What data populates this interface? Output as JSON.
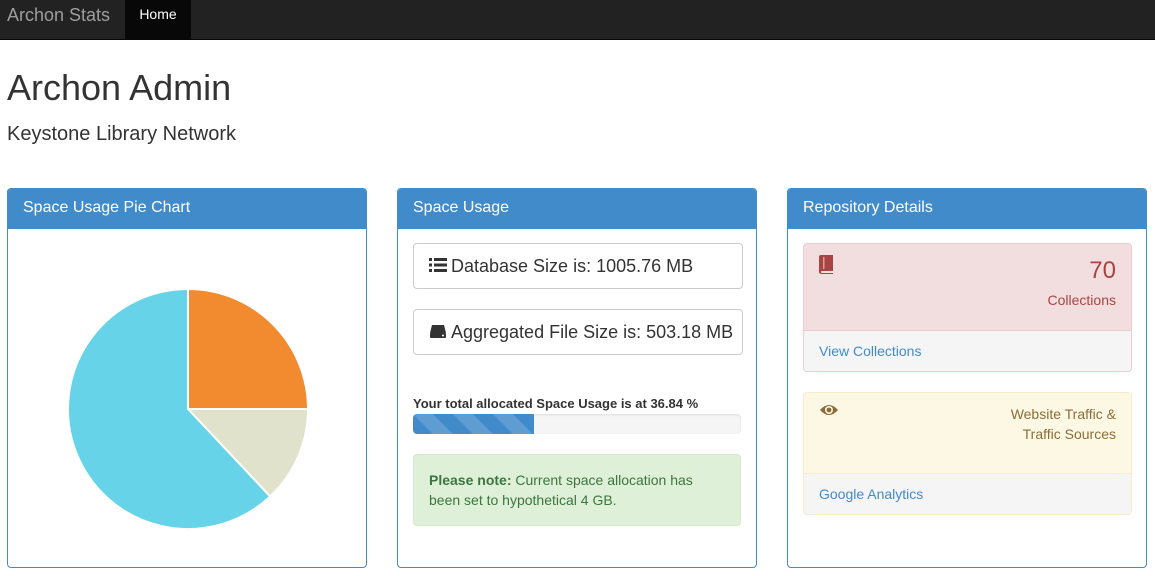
{
  "navbar": {
    "brand": "Archon Stats",
    "home_label": "Home"
  },
  "header": {
    "title": "Archon Admin",
    "subtitle": "Keystone Library Network"
  },
  "pie_panel": {
    "heading": "Space Usage Pie Chart"
  },
  "chart_data": {
    "type": "pie",
    "values": [
      25,
      13,
      62
    ],
    "colors": [
      "#f28b30",
      "#e1e2cc",
      "#67d3e8"
    ]
  },
  "space_panel": {
    "heading": "Space Usage",
    "database_size": "Database Size is: 1005.76 MB",
    "file_size": "Aggregated File Size is: 503.18 MB",
    "usage_label": "Your total allocated Space Usage is at 36.84 %",
    "usage_percent": 36.84,
    "note_bold": "Please note:",
    "note_text": " Current space allocation has been set to hypothetical 4 GB.",
    "icons": [
      "list-icon",
      "hard-drive-icon"
    ]
  },
  "repo_panel": {
    "heading": "Repository Details",
    "collections_count": "70",
    "collections_label": "Collections",
    "collections_link": "View Collections",
    "traffic_label": "Website Traffic & Traffic Sources",
    "traffic_link": "Google Analytics",
    "icons": [
      "book-icon",
      "eye-icon"
    ]
  },
  "colors": {
    "primary": "#428bca",
    "danger_text": "#a94442",
    "warning_text": "#8a6d3b",
    "success_text": "#3c763d"
  }
}
